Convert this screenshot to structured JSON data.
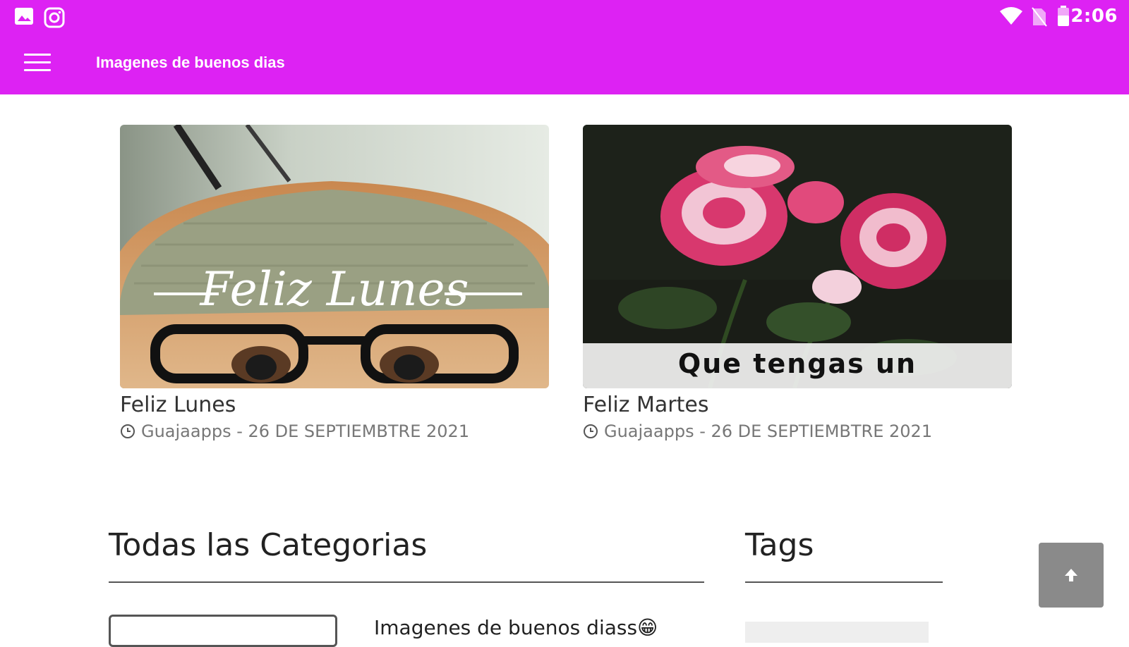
{
  "status_bar": {
    "time": "2:06",
    "left_icons": [
      "gallery-icon",
      "instagram-icon"
    ],
    "right_icons": [
      "wifi-icon",
      "no-sim-icon",
      "battery-icon"
    ]
  },
  "app_bar": {
    "title": "Imagenes de buenos dias",
    "menu_icon": "hamburger-menu-icon",
    "background": "#dd22f3"
  },
  "posts": [
    {
      "image_text": "Feliz Lunes",
      "title": "Feliz Lunes",
      "meta": "Guajaapps - 26 DE SEPTIEMBTRE 2021"
    },
    {
      "image_text": "Que tengas un",
      "title": "Feliz Martes",
      "meta": "Guajaapps - 26 DE SEPTIEMBTRE 2021"
    }
  ],
  "sections": {
    "categories_heading": "Todas las Categorias",
    "tags_heading": "Tags",
    "category_item": "Imagenes de buenos diass😁"
  },
  "scroll_top_icon": "arrow-up-icon",
  "colors": {
    "accent": "#dd22f3",
    "scroll_button": "#8a8a8a"
  }
}
